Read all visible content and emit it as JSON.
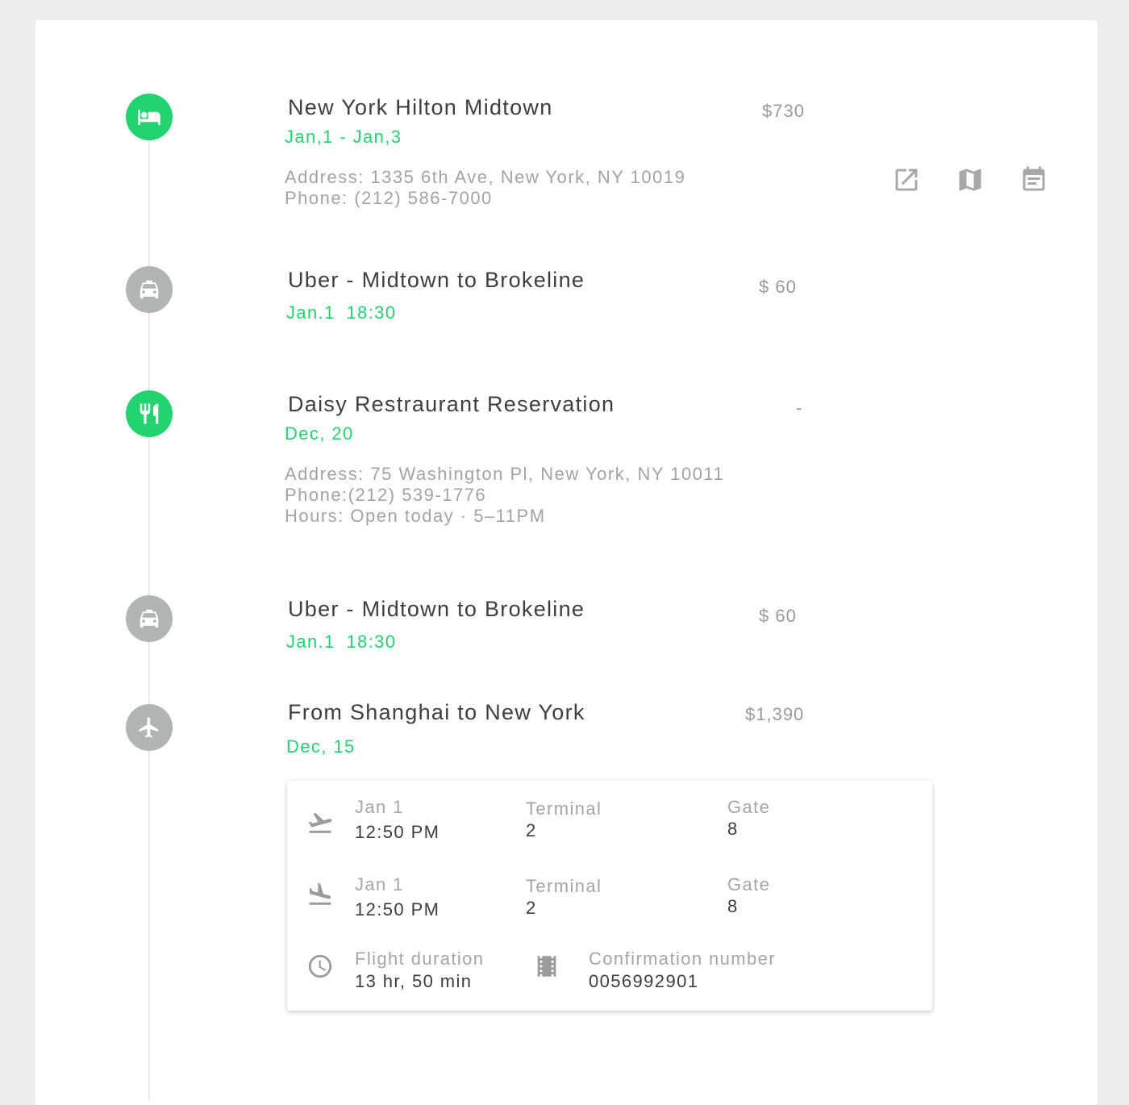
{
  "colors": {
    "accent_green": "#23d36f",
    "node_grey": "#b0b4b2",
    "page_bg": "#eceeed",
    "card_bg": "#ffffff"
  },
  "items": [
    {
      "icon": "hotel-bed-icon",
      "title": "New York Hilton Midtown",
      "date": "Jan,1 - Jan,3",
      "price": "$730",
      "address": "Address: 1335 6th Ave, New York, NY 10019",
      "phone": "Phone: (212) 586-7000"
    },
    {
      "icon": "taxi-icon",
      "title": "Uber - Midtown to Brokeline",
      "date": "Jan.1  18:30",
      "price": "$ 60"
    },
    {
      "icon": "restaurant-icon",
      "title": "Daisy Restraurant Reservation",
      "date": "Dec, 20",
      "price": "-",
      "address": "Address: 75 Washington Pl, New York, NY 10011",
      "phone": "Phone:(212) 539-1776",
      "hours": "Hours: Open today · 5–11PM"
    },
    {
      "icon": "taxi-icon",
      "title": "Uber - Midtown to Brokeline",
      "date": "Jan.1  18:30",
      "price": "$ 60"
    },
    {
      "icon": "airplane-icon",
      "title": "From Shanghai to New York",
      "date": "Dec, 15",
      "price": "$1,390"
    }
  ],
  "actions": [
    "open-external-icon",
    "map-icon",
    "calendar-event-icon"
  ],
  "flight": {
    "departure": {
      "icon": "flight-takeoff-icon",
      "date": "Jan 1",
      "time": "12:50 PM",
      "terminal_label": "Terminal",
      "terminal": "2",
      "gate_label": "Gate",
      "gate": "8"
    },
    "arrival": {
      "icon": "flight-land-icon",
      "date": "Jan 1",
      "time": "12:50 PM",
      "terminal_label": "Terminal",
      "terminal": "2",
      "gate_label": "Gate",
      "gate": "8"
    },
    "duration_label": "Flight duration",
    "duration": "13 hr, 50 min",
    "confirmation_label": "Confirmation number",
    "confirmation": "0056992901"
  }
}
